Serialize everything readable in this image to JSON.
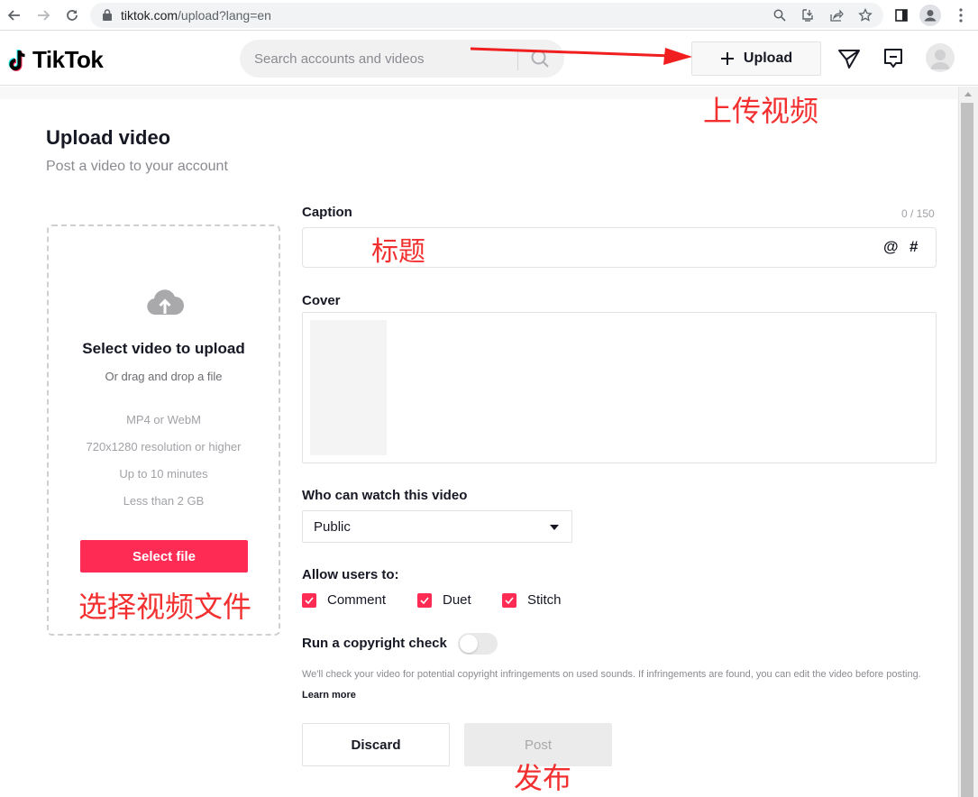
{
  "browser": {
    "url_host": "tiktok.com",
    "url_path": "/upload?lang=en",
    "icons": [
      "back-icon",
      "forward-icon",
      "reload-icon",
      "lock-icon",
      "zoom-icon",
      "install-app-icon",
      "share-icon",
      "bookmark-star-icon",
      "side-panel-icon",
      "profile-icon",
      "menu-kebab-icon"
    ]
  },
  "header": {
    "logo_text": "TikTok",
    "search_placeholder": "Search accounts and videos",
    "upload_label": "Upload",
    "icons": [
      "send-icon",
      "inbox-icon",
      "avatar-icon"
    ]
  },
  "page": {
    "title": "Upload video",
    "subtitle": "Post a video to your account"
  },
  "dropzone": {
    "title": "Select video to upload",
    "subtitle": "Or drag and drop a file",
    "requirements": [
      "MP4 or WebM",
      "720x1280 resolution or higher",
      "Up to 10 minutes",
      "Less than 2 GB"
    ],
    "button_label": "Select file"
  },
  "form": {
    "caption_label": "Caption",
    "caption_value": "",
    "caption_counter": "0 / 150",
    "mention_symbol": "@",
    "hashtag_symbol": "#",
    "cover_label": "Cover",
    "privacy_label": "Who can watch this video",
    "privacy_value": "Public",
    "allow_label": "Allow users to:",
    "allow_options": [
      {
        "label": "Comment",
        "checked": true
      },
      {
        "label": "Duet",
        "checked": true
      },
      {
        "label": "Stitch",
        "checked": true
      }
    ],
    "copyright_label": "Run a copyright check",
    "copyright_enabled": false,
    "copyright_note": "We'll check your video for potential copyright infringements on used sounds. If infringements are found, you can edit the video before posting.",
    "learn_more": "Learn more",
    "discard_label": "Discard",
    "post_label": "Post"
  },
  "annotations": {
    "upload": "上传视频",
    "caption": "标题",
    "select_file": "选择视频文件",
    "post": "发布",
    "color": "#f23030"
  },
  "colors": {
    "brand_primary": "#fe2c55",
    "text_primary": "#161823",
    "text_secondary": "#8a8b91"
  }
}
